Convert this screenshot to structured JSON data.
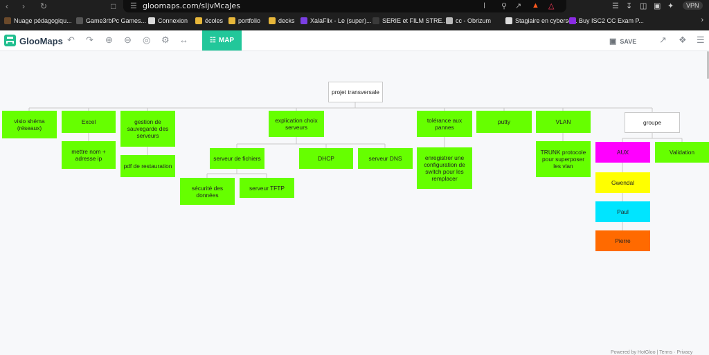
{
  "browser": {
    "url": "gloomaps.com/sIjvMcaJes",
    "vpn_label": "VPN"
  },
  "bookmarks": [
    {
      "label": "Nuage pédagogiqu...",
      "color": "#6b4a2b"
    },
    {
      "label": "Game3rbPc Games...",
      "color": "#555555"
    },
    {
      "label": "Connexion",
      "color": "#dcdcdc"
    },
    {
      "label": "écoles",
      "color": "#e8b73a"
    },
    {
      "label": "portfolio",
      "color": "#e8b73a"
    },
    {
      "label": "decks",
      "color": "#e8b73a"
    },
    {
      "label": "XalaFlix - Le (super)...",
      "color": "#7b3fe4"
    },
    {
      "label": "SERIE et FILM STRE...",
      "color": "#3a3a3a"
    },
    {
      "label": "cc - Obrizum",
      "color": "#bbbbbb"
    },
    {
      "label": "Stagiaire en cybersé...",
      "color": "#dddddd"
    },
    {
      "label": "Buy ISC2 CC Exam P...",
      "color": "#8a2be2"
    }
  ],
  "app": {
    "logo": "GlooMaps",
    "map_tab": "MAP",
    "save_label": "SAVE",
    "toolbar_icons": [
      "undo-icon",
      "redo-icon",
      "zoom-in-icon",
      "zoom-out-icon",
      "target-icon",
      "gear-icon",
      "width-icon"
    ],
    "accent": "#22c79a"
  },
  "map": {
    "root": "projet transversale",
    "node_color": "#66ff00",
    "nodes": {
      "visio": "visio shéma (réseaux)",
      "excel": "Excel",
      "excel_child": "mettre nom + adresse ip",
      "gestion": "gestion de sauvegarde des serveurs",
      "gestion_child": "pdf de restauration",
      "explication": "explication choix serveurs",
      "fichiers": "serveur de fichiers",
      "securite": "sécurité des données",
      "tftp": "serveur TFTP",
      "dhcp": "DHCP",
      "dns": "serveur DNS",
      "tolerance": "tolérance aux pannes",
      "tolerance_child": "enregistrer une configuration de switch pour les remplacer",
      "putty": "putty",
      "vlan": "VLAN",
      "vlan_child": "TRUNK protocole pour superposer les vlan",
      "groupe": "groupe",
      "aux": "AUX",
      "gwendal": "Gwendal",
      "paul": "Paul",
      "pierre": "Pierre",
      "validation": "Validation"
    },
    "group_colors": {
      "aux": "#ff00ff",
      "gwendal": "#ffff00",
      "paul": "#00e5ff",
      "pierre": "#ff6a00"
    }
  },
  "footer": "Powered by HotGloo | Terms · Privacy"
}
